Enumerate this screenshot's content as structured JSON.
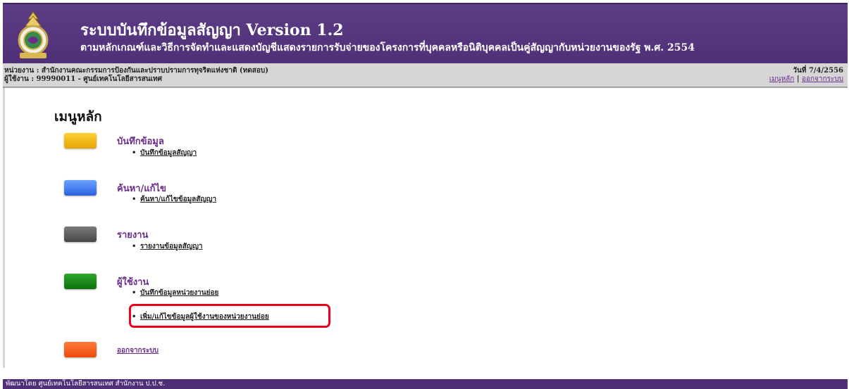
{
  "header": {
    "title": "ระบบบันทึกข้อมูลสัญญา Version 1.2",
    "subtitle": "ตามหลักเกณฑ์และวิธีการจัดทำและแสดงบัญชีแสดงรายการรับจ่ายของโครงการที่บุคคลหรือนิติบุคคลเป็นคู่สัญญากับหน่วยงานของรัฐ พ.ศ. 2554",
    "logo_icon": "agency-emblem-icon"
  },
  "infobar": {
    "agency": "หน่วยงาน : สำนักงานคณะกรรมการป้องกันและปราบปรามการทุจริตแห่งชาติ (ทดสอบ)",
    "user": "ผู้ใช้งาน : 99990011 - ศูนย์เทคโนโลยีสารสนเทศ",
    "date": "วันที่ 7/4/2556",
    "main_menu_link": "เมนูหลัก",
    "separator": " | ",
    "logout_link": "ออกจากระบบ"
  },
  "main": {
    "heading": "เมนูหลัก",
    "sections": [
      {
        "title": "บันทึกข้อมูล",
        "color": "#f5b800",
        "links": [
          "บันทึกข้อมูลสัญญา"
        ]
      },
      {
        "title": "ค้นหา/แก้ไข",
        "color": "#3a7bf0",
        "links": [
          "ค้นหา/แก้ไขข้อมูลสัญญา"
        ]
      },
      {
        "title": "รายงาน",
        "color": "#5a5a5a",
        "links": [
          "รายงานข้อมูลสัญญา"
        ]
      },
      {
        "title": "ผู้ใช้งาน",
        "color": "#1a8c1a",
        "links": [
          "บันทึกข้อมูลหน่วยงานย่อย",
          "เพิ่ม/แก้ไขข้อมูลผู้ใช้งานของหน่วยงานย่อย"
        ]
      }
    ],
    "logout": {
      "label": "ออกจากระบบ",
      "color": "#ff5a1f"
    },
    "highlight_color": "#e8001c"
  },
  "footer": {
    "text": "พัฒนาโดย ศูนย์เทคโนโลยีสารสนเทศ สำนักงาน ป.ป.ช."
  }
}
